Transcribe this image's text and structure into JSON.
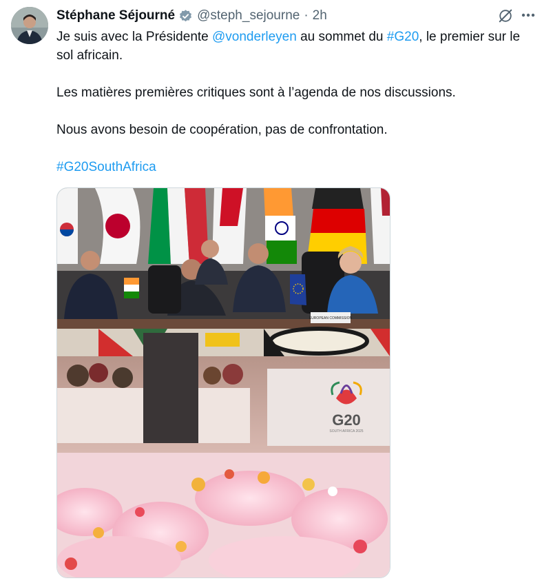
{
  "author": {
    "name": "Stéphane Séjourné",
    "handle": "@steph_sejourne",
    "separator": "·",
    "time": "2h",
    "verified_color": "#829aab"
  },
  "tweet": {
    "line1_pre": "Je suis avec la Présidente ",
    "mention": "@vonderleyen",
    "line1_mid": " au sommet du ",
    "hashtag1": "#G20",
    "line1_post": ", le premier sur le sol africain.",
    "para2": "Les matières premières critiques sont à l’agenda de nos discussions.",
    "para3": "Nous avons besoin de coopération, pas de confrontation.",
    "hashtag2": "#G20SouthAfrica"
  },
  "media": {
    "placards": [
      "EUROPEAN COMMISSION"
    ],
    "logo_text": "G20",
    "logo_sub": "SOUTH AFRICA 2025"
  },
  "icons": [
    "verified-badge-icon",
    "grok-icon",
    "more-icon"
  ],
  "colors": {
    "link": "#1d9bf0",
    "secondary": "#536471"
  }
}
